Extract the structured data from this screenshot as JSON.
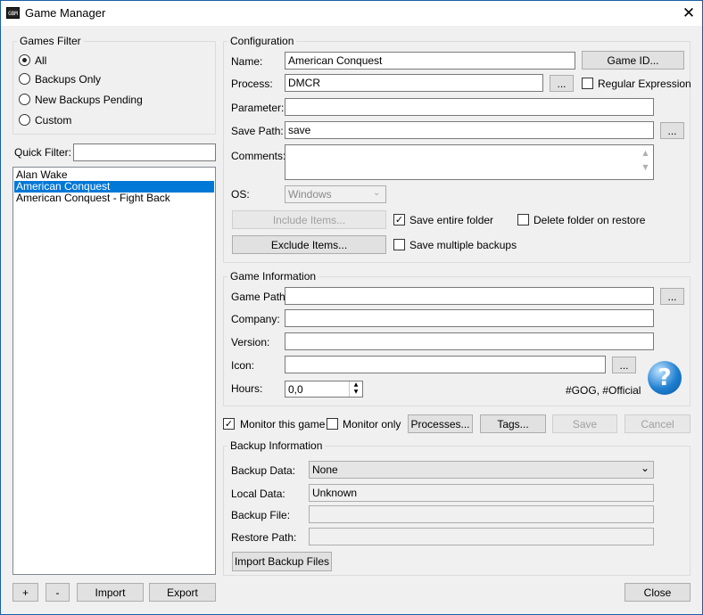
{
  "window": {
    "title": "Game Manager",
    "icon_text": "GBM"
  },
  "filter": {
    "legend": "Games Filter",
    "options": [
      {
        "label": "All",
        "checked": true
      },
      {
        "label": "Backups Only",
        "checked": false
      },
      {
        "label": "New Backups Pending",
        "checked": false
      },
      {
        "label": "Custom",
        "checked": false
      }
    ],
    "quick_filter_label": "Quick Filter:",
    "quick_filter_value": ""
  },
  "games": [
    "Alan Wake",
    "American Conquest",
    "American Conquest - Fight Back"
  ],
  "selected_game": "American Conquest",
  "bottom_left": {
    "add": "+",
    "remove": "-",
    "import": "Import",
    "export": "Export"
  },
  "config": {
    "legend": "Configuration",
    "name_label": "Name:",
    "name_value": "American Conquest",
    "game_id_button": "Game ID...",
    "process_label": "Process:",
    "process_value": "DMCR",
    "browse": "...",
    "regex_label": "Regular Expression",
    "regex_checked": false,
    "parameter_label": "Parameter:",
    "parameter_value": "",
    "save_path_label": "Save Path:",
    "save_path_value": "save",
    "comments_label": "Comments:",
    "comments_value": "",
    "os_label": "OS:",
    "os_value": "Windows",
    "include_button": "Include Items...",
    "exclude_button": "Exclude Items...",
    "save_entire_label": "Save entire folder",
    "save_entire_checked": true,
    "delete_folder_label": "Delete folder on restore",
    "delete_folder_checked": false,
    "save_multiple_label": "Save multiple backups",
    "save_multiple_checked": false
  },
  "game_info": {
    "legend": "Game Information",
    "game_path_label": "Game Path:",
    "game_path_value": "",
    "company_label": "Company:",
    "company_value": "",
    "version_label": "Version:",
    "version_value": "",
    "icon_label": "Icon:",
    "icon_value": "",
    "hours_label": "Hours:",
    "hours_value": "0,0",
    "tags_text": "#GOG, #Official",
    "help_glyph": "?"
  },
  "actions": {
    "monitor_label": "Monitor this game",
    "monitor_checked": true,
    "monitor_only_label": "Monitor only",
    "monitor_only_checked": false,
    "processes": "Processes...",
    "tags": "Tags...",
    "save": "Save",
    "cancel": "Cancel"
  },
  "backup": {
    "legend": "Backup Information",
    "backup_data_label": "Backup Data:",
    "backup_data_value": "None",
    "local_data_label": "Local Data:",
    "local_data_value": "Unknown",
    "backup_file_label": "Backup File:",
    "backup_file_value": "",
    "restore_path_label": "Restore Path:",
    "restore_path_value": "",
    "import_button": "Import Backup Files"
  },
  "close_button": "Close",
  "colors": {
    "selection": "#0078d7",
    "window_border": "#1c5fa6",
    "help_icon": "#1e7fd0"
  },
  "icons": {
    "close": "close-icon",
    "help": "help-icon",
    "dropdown": "chevron-down-icon"
  }
}
